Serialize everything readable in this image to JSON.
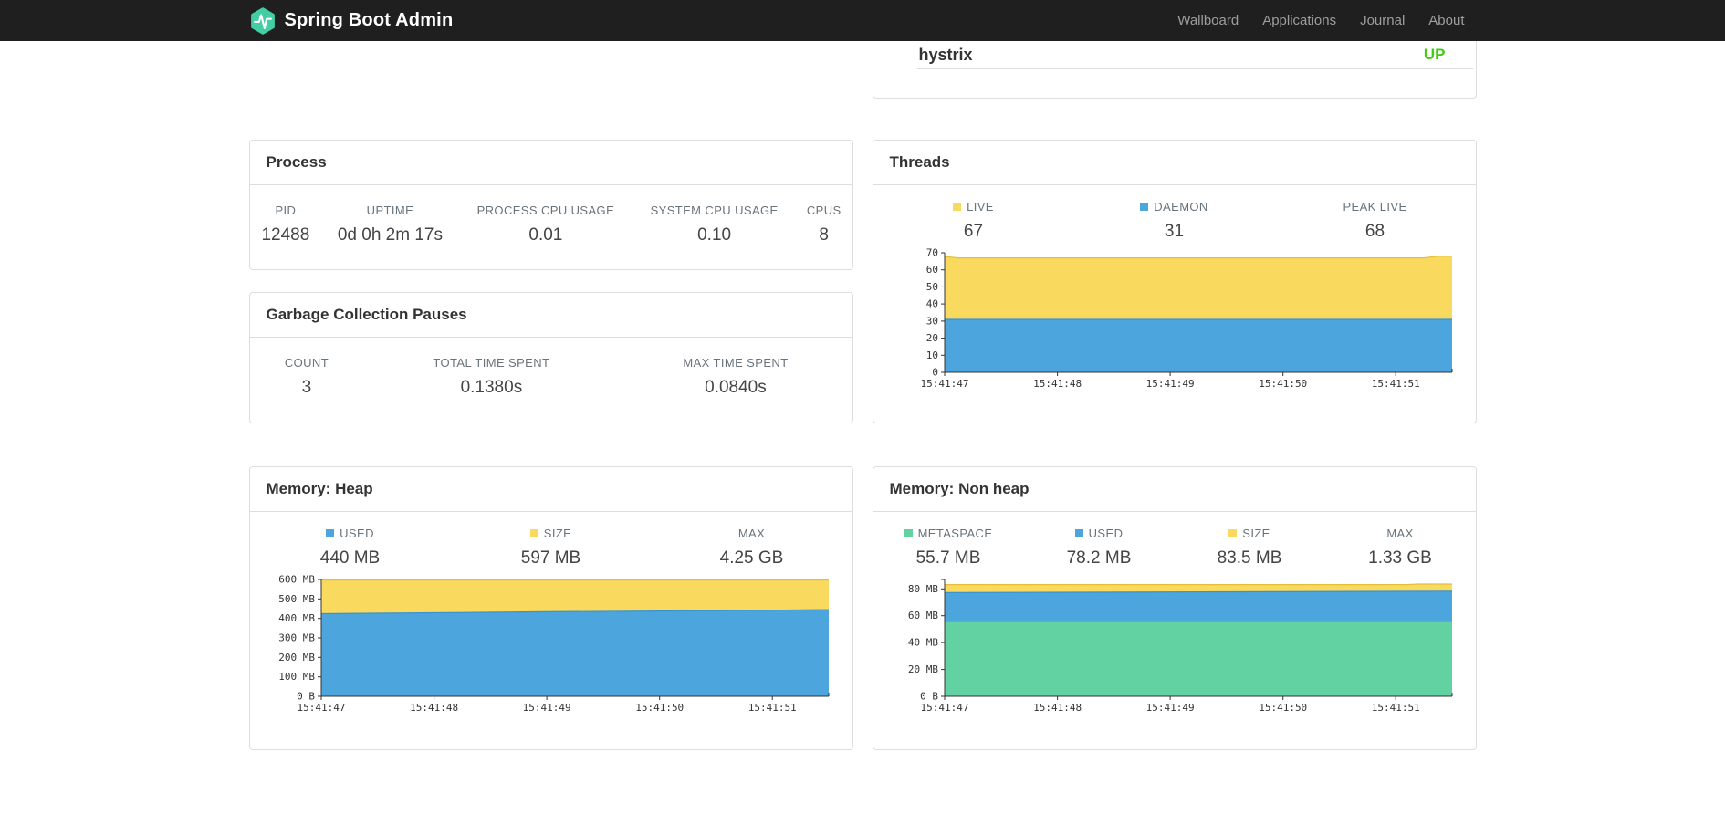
{
  "navbar": {
    "brand": "Spring Boot Admin",
    "items": [
      {
        "label": "Wallboard"
      },
      {
        "label": "Applications"
      },
      {
        "label": "Journal"
      },
      {
        "label": "About"
      }
    ]
  },
  "colors": {
    "brand_green": "#42cea2",
    "chart_yellow": "#fad95f",
    "chart_blue": "#4da5de",
    "chart_green": "#63d2a2",
    "status_up": "#44cc11"
  },
  "application_panel": {
    "name": "hystrix",
    "status": "UP",
    "status_color": "#44cc11"
  },
  "panels": {
    "process": {
      "title": "Process",
      "metrics": [
        {
          "label": "PID",
          "value": "12488"
        },
        {
          "label": "UPTIME",
          "value": "0d 0h 2m 17s"
        },
        {
          "label": "PROCESS CPU USAGE",
          "value": "0.01"
        },
        {
          "label": "SYSTEM CPU USAGE",
          "value": "0.10"
        },
        {
          "label": "CPUS",
          "value": "8"
        }
      ]
    },
    "gc": {
      "title": "Garbage Collection Pauses",
      "metrics": [
        {
          "label": "COUNT",
          "value": "3"
        },
        {
          "label": "TOTAL TIME SPENT",
          "value": "0.1380s"
        },
        {
          "label": "MAX TIME SPENT",
          "value": "0.0840s"
        }
      ]
    },
    "threads": {
      "title": "Threads",
      "legend": [
        {
          "label": "LIVE",
          "value": "67",
          "color": "#fad95f"
        },
        {
          "label": "DAEMON",
          "value": "31",
          "color": "#4da5de"
        },
        {
          "label": "PEAK LIVE",
          "value": "68"
        }
      ]
    },
    "heap": {
      "title": "Memory: Heap",
      "legend": [
        {
          "label": "USED",
          "value": "440 MB",
          "color": "#4da5de"
        },
        {
          "label": "SIZE",
          "value": "597 MB",
          "color": "#fad95f"
        },
        {
          "label": "MAX",
          "value": "4.25 GB"
        }
      ]
    },
    "nonheap": {
      "title": "Memory: Non heap",
      "legend": [
        {
          "label": "METASPACE",
          "value": "55.7 MB",
          "color": "#63d2a2"
        },
        {
          "label": "USED",
          "value": "78.2 MB",
          "color": "#4da5de"
        },
        {
          "label": "SIZE",
          "value": "83.5 MB",
          "color": "#fad95f"
        },
        {
          "label": "MAX",
          "value": "1.33 GB"
        }
      ]
    }
  },
  "chart_data": [
    {
      "id": "threads",
      "type": "area",
      "title": "Threads",
      "height": 167,
      "x_labels": [
        "15:41:47",
        "15:41:48",
        "15:41:49",
        "15:41:50",
        "15:41:51"
      ],
      "x_domain": [
        0,
        4.5
      ],
      "y_max": 70,
      "y_ticks": [
        {
          "v": 0,
          "label": "0"
        },
        {
          "v": 10,
          "label": "10"
        },
        {
          "v": 20,
          "label": "20"
        },
        {
          "v": 30,
          "label": "30"
        },
        {
          "v": 40,
          "label": "40"
        },
        {
          "v": 50,
          "label": "50"
        },
        {
          "v": 60,
          "label": "60"
        },
        {
          "v": 70,
          "label": "70"
        }
      ],
      "series": [
        {
          "name": "LIVE",
          "color": "#fad95f",
          "stroke": "#e3bf3c",
          "points": [
            [
              0,
              67.8
            ],
            [
              0.12,
              67
            ],
            [
              4.25,
              67
            ],
            [
              4.38,
              68
            ],
            [
              4.5,
              68
            ]
          ]
        },
        {
          "name": "DAEMON",
          "color": "#4da5de",
          "stroke": "#3b93cd",
          "points": [
            [
              0,
              31
            ],
            [
              4.5,
              31
            ]
          ]
        }
      ]
    },
    {
      "id": "heap",
      "type": "area",
      "title": "Memory: Heap",
      "height": 164,
      "x_labels": [
        "15:41:47",
        "15:41:48",
        "15:41:49",
        "15:41:50",
        "15:41:51"
      ],
      "x_domain": [
        0,
        4.5
      ],
      "y_max": 600,
      "y_ticks": [
        {
          "v": 0,
          "label": "0 B"
        },
        {
          "v": 100,
          "label": "100 MB"
        },
        {
          "v": 200,
          "label": "200 MB"
        },
        {
          "v": 300,
          "label": "300 MB"
        },
        {
          "v": 400,
          "label": "400 MB"
        },
        {
          "v": 500,
          "label": "500 MB"
        },
        {
          "v": 600,
          "label": "600 MB"
        }
      ],
      "series": [
        {
          "name": "SIZE",
          "color": "#fad95f",
          "stroke": "#e3bf3c",
          "points": [
            [
              0,
              597
            ],
            [
              4.5,
              597
            ]
          ]
        },
        {
          "name": "USED",
          "color": "#4da5de",
          "stroke": "#3b93cd",
          "points": [
            [
              0,
              424
            ],
            [
              1,
              429
            ],
            [
              2,
              434
            ],
            [
              3,
              438
            ],
            [
              4,
              442
            ],
            [
              4.5,
              445
            ]
          ]
        }
      ]
    },
    {
      "id": "nonheap",
      "type": "area",
      "title": "Memory: Non heap",
      "height": 164,
      "x_labels": [
        "15:41:47",
        "15:41:48",
        "15:41:49",
        "15:41:50",
        "15:41:51"
      ],
      "x_domain": [
        0,
        4.5
      ],
      "y_max": 87,
      "y_ticks": [
        {
          "v": 0,
          "label": "0 B"
        },
        {
          "v": 20,
          "label": "20 MB"
        },
        {
          "v": 40,
          "label": "40 MB"
        },
        {
          "v": 60,
          "label": "60 MB"
        },
        {
          "v": 80,
          "label": "80 MB"
        }
      ],
      "series": [
        {
          "name": "SIZE",
          "color": "#fad95f",
          "stroke": "#e3bf3c",
          "points": [
            [
              0,
              83.2
            ],
            [
              4.1,
              83.2
            ],
            [
              4.2,
              83.6
            ],
            [
              4.5,
              83.6
            ]
          ]
        },
        {
          "name": "USED",
          "color": "#4da5de",
          "stroke": "#3b93cd",
          "points": [
            [
              0,
              77.2
            ],
            [
              4.5,
              78.3
            ]
          ]
        },
        {
          "name": "METASPACE",
          "color": "#63d2a2",
          "stroke": "#46bd8b",
          "points": [
            [
              0,
              55.6
            ],
            [
              4.5,
              55.7
            ]
          ]
        }
      ]
    }
  ]
}
